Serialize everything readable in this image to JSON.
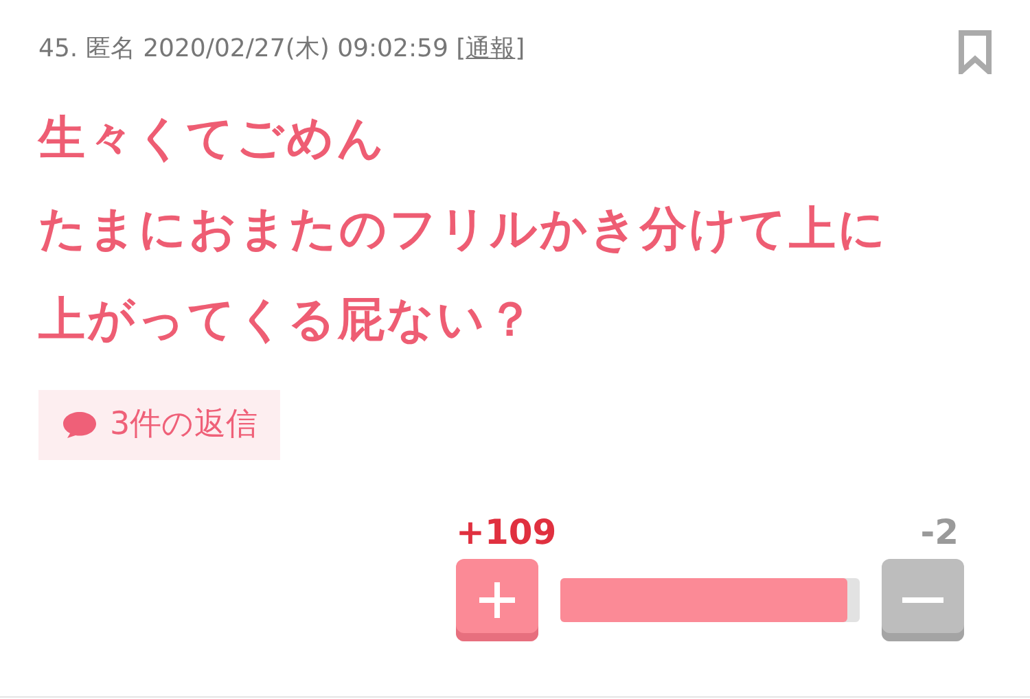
{
  "post": {
    "number": "45.",
    "author": "匿名",
    "datetime": "2020/02/27(木) 09:02:59",
    "report_open": "[",
    "report_link": "通報",
    "report_close": "]",
    "bookmarked": false
  },
  "body": [
    "生々くてごめん",
    "たまにおまたのフリルかき分けて上に",
    "上がってくる屁ない？"
  ],
  "replies": {
    "label": "3件の返信"
  },
  "votes": {
    "plus_count": "+109",
    "minus_count": "-2",
    "level": 0.96
  }
}
